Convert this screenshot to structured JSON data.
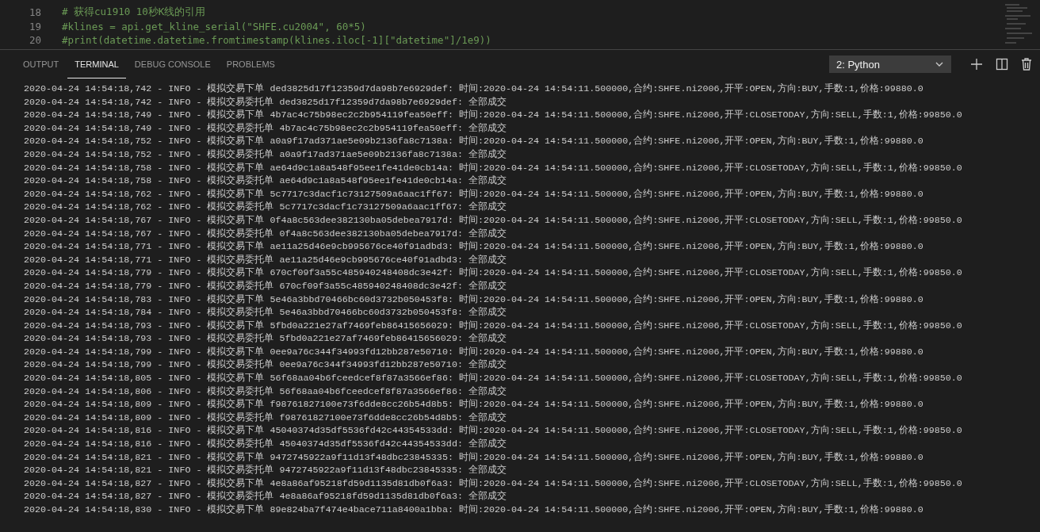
{
  "editor": {
    "lines": [
      {
        "number": "18",
        "text": "# 获得cu1910 10秒K线的引用"
      },
      {
        "number": "19",
        "text": "#klines = api.get_kline_serial(\"SHFE.cu2004\", 60*5)"
      },
      {
        "number": "20",
        "text": "#print(datetime.datetime.fromtimestamp(klines.iloc[-1][\"datetime\"]/1e9))"
      }
    ]
  },
  "panel": {
    "tabs": [
      {
        "label": "OUTPUT",
        "selected": false
      },
      {
        "label": "TERMINAL",
        "selected": true
      },
      {
        "label": "DEBUG CONSOLE",
        "selected": false
      },
      {
        "label": "PROBLEMS",
        "selected": false
      }
    ],
    "terminal_select": {
      "value": "2: Python"
    }
  },
  "terminal": {
    "lines": [
      "2020-04-24 14:54:18,742 - INFO - 模拟交易下单 ded3825d17f12359d7da98b7e6929def: 时间:2020-04-24 14:54:11.500000,合约:SHFE.ni2006,开平:OPEN,方向:BUY,手数:1,价格:99880.0",
      "2020-04-24 14:54:18,742 - INFO - 模拟交易委托单 ded3825d17f12359d7da98b7e6929def: 全部成交",
      "2020-04-24 14:54:18,749 - INFO - 模拟交易下单 4b7ac4c75b98ec2c2b954119fea50eff: 时间:2020-04-24 14:54:11.500000,合约:SHFE.ni2006,开平:CLOSETODAY,方向:SELL,手数:1,价格:99850.0",
      "2020-04-24 14:54:18,749 - INFO - 模拟交易委托单 4b7ac4c75b98ec2c2b954119fea50eff: 全部成交",
      "2020-04-24 14:54:18,752 - INFO - 模拟交易下单 a0a9f17ad371ae5e09b2136fa8c7138a: 时间:2020-04-24 14:54:11.500000,合约:SHFE.ni2006,开平:OPEN,方向:BUY,手数:1,价格:99880.0",
      "2020-04-24 14:54:18,752 - INFO - 模拟交易委托单 a0a9f17ad371ae5e09b2136fa8c7138a: 全部成交",
      "2020-04-24 14:54:18,758 - INFO - 模拟交易下单 ae64d9c1a8a548f95ee1fe41de0cb14a: 时间:2020-04-24 14:54:11.500000,合约:SHFE.ni2006,开平:CLOSETODAY,方向:SELL,手数:1,价格:99850.0",
      "2020-04-24 14:54:18,758 - INFO - 模拟交易委托单 ae64d9c1a8a548f95ee1fe41de0cb14a: 全部成交",
      "2020-04-24 14:54:18,762 - INFO - 模拟交易下单 5c7717c3dacf1c73127509a6aac1ff67: 时间:2020-04-24 14:54:11.500000,合约:SHFE.ni2006,开平:OPEN,方向:BUY,手数:1,价格:99880.0",
      "2020-04-24 14:54:18,762 - INFO - 模拟交易委托单 5c7717c3dacf1c73127509a6aac1ff67: 全部成交",
      "2020-04-24 14:54:18,767 - INFO - 模拟交易下单 0f4a8c563dee382130ba05debea7917d: 时间:2020-04-24 14:54:11.500000,合约:SHFE.ni2006,开平:CLOSETODAY,方向:SELL,手数:1,价格:99850.0",
      "2020-04-24 14:54:18,767 - INFO - 模拟交易委托单 0f4a8c563dee382130ba05debea7917d: 全部成交",
      "2020-04-24 14:54:18,771 - INFO - 模拟交易下单 ae11a25d46e9cb995676ce40f91adbd3: 时间:2020-04-24 14:54:11.500000,合约:SHFE.ni2006,开平:OPEN,方向:BUY,手数:1,价格:99880.0",
      "2020-04-24 14:54:18,771 - INFO - 模拟交易委托单 ae11a25d46e9cb995676ce40f91adbd3: 全部成交",
      "2020-04-24 14:54:18,779 - INFO - 模拟交易下单 670cf09f3a55c485940248408dc3e42f: 时间:2020-04-24 14:54:11.500000,合约:SHFE.ni2006,开平:CLOSETODAY,方向:SELL,手数:1,价格:99850.0",
      "2020-04-24 14:54:18,779 - INFO - 模拟交易委托单 670cf09f3a55c485940248408dc3e42f: 全部成交",
      "2020-04-24 14:54:18,783 - INFO - 模拟交易下单 5e46a3bbd70466bc60d3732b050453f8: 时间:2020-04-24 14:54:11.500000,合约:SHFE.ni2006,开平:OPEN,方向:BUY,手数:1,价格:99880.0",
      "2020-04-24 14:54:18,784 - INFO - 模拟交易委托单 5e46a3bbd70466bc60d3732b050453f8: 全部成交",
      "2020-04-24 14:54:18,793 - INFO - 模拟交易下单 5fbd0a221e27af7469feb86415656029: 时间:2020-04-24 14:54:11.500000,合约:SHFE.ni2006,开平:CLOSETODAY,方向:SELL,手数:1,价格:99850.0",
      "2020-04-24 14:54:18,793 - INFO - 模拟交易委托单 5fbd0a221e27af7469feb86415656029: 全部成交",
      "2020-04-24 14:54:18,799 - INFO - 模拟交易下单 0ee9a76c344f34993fd12bb287e50710: 时间:2020-04-24 14:54:11.500000,合约:SHFE.ni2006,开平:OPEN,方向:BUY,手数:1,价格:99880.0",
      "2020-04-24 14:54:18,799 - INFO - 模拟交易委托单 0ee9a76c344f34993fd12bb287e50710: 全部成交",
      "2020-04-24 14:54:18,805 - INFO - 模拟交易下单 56f68aa04b6fceedcef8f87a3566ef86: 时间:2020-04-24 14:54:11.500000,合约:SHFE.ni2006,开平:CLOSETODAY,方向:SELL,手数:1,价格:99850.0",
      "2020-04-24 14:54:18,806 - INFO - 模拟交易委托单 56f68aa04b6fceedcef8f87a3566ef86: 全部成交",
      "2020-04-24 14:54:18,809 - INFO - 模拟交易下单 f98761827100e73f6dde8cc26b54d8b5: 时间:2020-04-24 14:54:11.500000,合约:SHFE.ni2006,开平:OPEN,方向:BUY,手数:1,价格:99880.0",
      "2020-04-24 14:54:18,809 - INFO - 模拟交易委托单 f98761827100e73f6dde8cc26b54d8b5: 全部成交",
      "2020-04-24 14:54:18,816 - INFO - 模拟交易下单 45040374d35df5536fd42c44354533dd: 时间:2020-04-24 14:54:11.500000,合约:SHFE.ni2006,开平:CLOSETODAY,方向:SELL,手数:1,价格:99850.0",
      "2020-04-24 14:54:18,816 - INFO - 模拟交易委托单 45040374d35df5536fd42c44354533dd: 全部成交",
      "2020-04-24 14:54:18,821 - INFO - 模拟交易下单 9472745922a9f11d13f48dbc23845335: 时间:2020-04-24 14:54:11.500000,合约:SHFE.ni2006,开平:OPEN,方向:BUY,手数:1,价格:99880.0",
      "2020-04-24 14:54:18,821 - INFO - 模拟交易委托单 9472745922a9f11d13f48dbc23845335: 全部成交",
      "2020-04-24 14:54:18,827 - INFO - 模拟交易下单 4e8a86af95218fd59d1135d81db0f6a3: 时间:2020-04-24 14:54:11.500000,合约:SHFE.ni2006,开平:CLOSETODAY,方向:SELL,手数:1,价格:99850.0",
      "2020-04-24 14:54:18,827 - INFO - 模拟交易委托单 4e8a86af95218fd59d1135d81db0f6a3: 全部成交",
      "2020-04-24 14:54:18,830 - INFO - 模拟交易下单 89e824ba7f474e4bace711a8400a1bba: 时间:2020-04-24 14:54:11.500000,合约:SHFE.ni2006,开平:OPEN,方向:BUY,手数:1,价格:99880.0"
    ]
  }
}
